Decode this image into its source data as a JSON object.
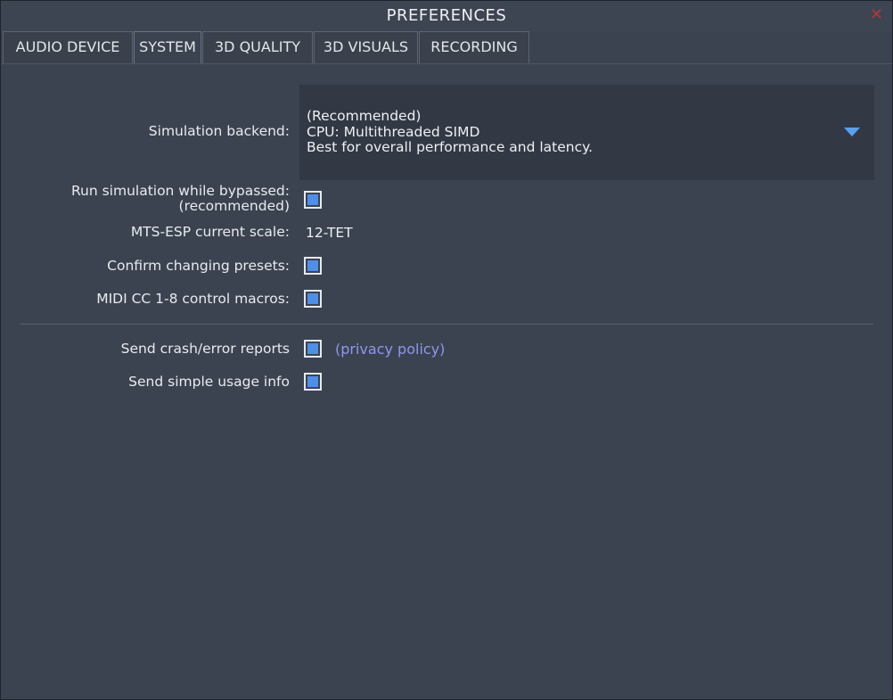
{
  "window": {
    "title": "PREFERENCES",
    "close_symbol": "✕"
  },
  "tabs": [
    {
      "label": "AUDIO DEVICE",
      "active": false
    },
    {
      "label": "SYSTEM",
      "active": true
    },
    {
      "label": "3D QUALITY",
      "active": false
    },
    {
      "label": "3D VISUALS",
      "active": false
    },
    {
      "label": "RECORDING",
      "active": false
    }
  ],
  "system": {
    "simulation_backend": {
      "label": "Simulation backend:",
      "selected": {
        "line1": "(Recommended)",
        "line2": "CPU: Multithreaded SIMD",
        "line3": "Best for overall performance and latency."
      }
    },
    "run_while_bypassed": {
      "label_line1": "Run simulation while bypassed:",
      "label_line2": "(recommended)",
      "checked": true
    },
    "mts_esp_scale": {
      "label": "MTS-ESP current scale:",
      "value": "12-TET"
    },
    "confirm_presets": {
      "label": "Confirm changing presets:",
      "checked": true
    },
    "midi_cc_macros": {
      "label": "MIDI CC 1-8 control macros:",
      "checked": true
    },
    "crash_reports": {
      "label": "Send crash/error reports",
      "checked": true,
      "link_text": "(privacy policy)"
    },
    "usage_info": {
      "label": "Send simple usage info",
      "checked": true
    }
  },
  "colors": {
    "background": "#3b4350",
    "dropdown_bg": "#323944",
    "accent_blue": "#4f8fe8",
    "link": "#8f96f0",
    "close_red": "#b8343a"
  },
  "icons": {
    "close": "close-icon",
    "dropdown_arrow": "dropdown-triangle-icon"
  }
}
